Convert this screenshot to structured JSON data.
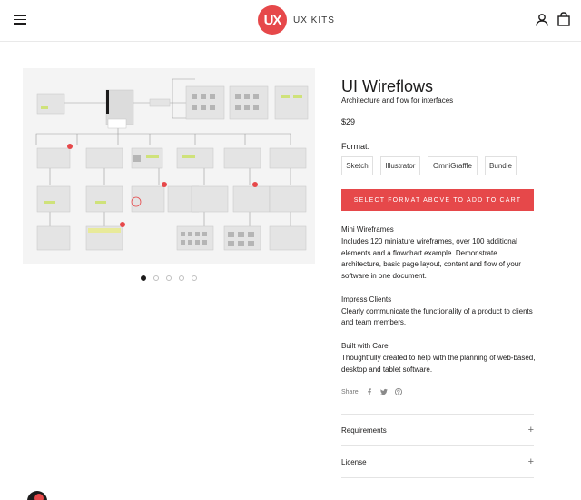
{
  "header": {
    "logo_mark": "UX",
    "logo_text": "UX KITS",
    "menu_icon": "hamburger-menu-icon",
    "account_icon": "user-icon",
    "cart_icon": "shopping-bag-icon"
  },
  "gallery": {
    "image": "wireframe-flowchart-image",
    "dot_count": 5,
    "active_dot": 0
  },
  "product": {
    "title": "UI Wireflows",
    "subtitle": "Architecture and flow for interfaces",
    "price": "$29",
    "format_label": "Format:",
    "formats": [
      "Sketch",
      "Illustrator",
      "OmniGraffle",
      "Bundle"
    ],
    "cart_button": "SELECT FORMAT ABOVE TO ADD TO CART",
    "description": [
      {
        "heading": "Mini Wireframes",
        "body": "Includes 120 miniature wireframes, over 100 additional elements and a flowchart example. Demonstrate architecture, basic page layout, content and flow of your software in one document."
      },
      {
        "heading": "Impress Clients",
        "body": "Clearly communicate the functionality of a product to clients and team members."
      },
      {
        "heading": "Built with Care",
        "body": "Thoughtfully created to help with the planning of web-based, desktop and tablet software."
      }
    ],
    "share_label": "Share",
    "share_icons": [
      "facebook-icon",
      "twitter-icon",
      "pinterest-icon"
    ],
    "accordions": [
      "Requirements",
      "License"
    ]
  },
  "colors": {
    "accent": "#e6484a",
    "text": "#1c1b1b",
    "border": "#e4e4e4"
  }
}
